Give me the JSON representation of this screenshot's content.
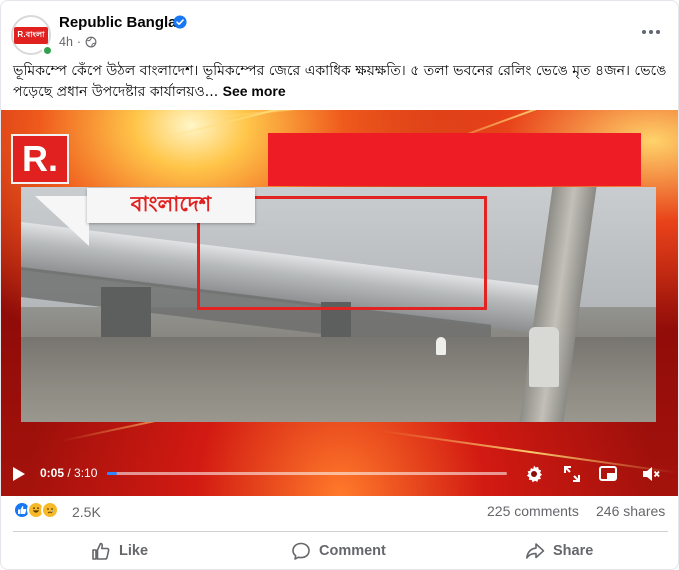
{
  "post": {
    "page_name": "Republic Bangla",
    "avatar_logo": "R.বাংলা",
    "time": "4h",
    "caption": "ভূমিকম্পে কেঁপে উঠল বাংলাদেশ। ভূমিকম্পের জেরে একাধিক ক্ষয়ক্ষতি। ৫ তলা ভবনের রেলিং ভেঙে মৃত ৪জন। ভেঙে পড়েছে প্রধান উপদেষ্টার কার্যালয়ও...",
    "see_more": "See more"
  },
  "video": {
    "logo_text": "R.",
    "callout_text": "বাংলাদেশ",
    "current_time": "0:05",
    "total_time": "3:10",
    "progress": 0.026,
    "colors": {
      "accent": "#2d88ff",
      "brand_red": "#e0211f"
    }
  },
  "footer": {
    "reactions": [
      "like",
      "haha",
      "sad"
    ],
    "reaction_count": "2.5K",
    "comments": "225 comments",
    "shares": "246 shares",
    "actions": {
      "like": "Like",
      "comment": "Comment",
      "share": "Share"
    }
  },
  "icons": [
    "verified-badge-icon",
    "globe-icon",
    "more-options-icon",
    "play-icon",
    "settings-icon",
    "fullscreen-icon",
    "mini-player-icon",
    "mute-icon",
    "like-icon",
    "comment-icon",
    "share-icon"
  ]
}
